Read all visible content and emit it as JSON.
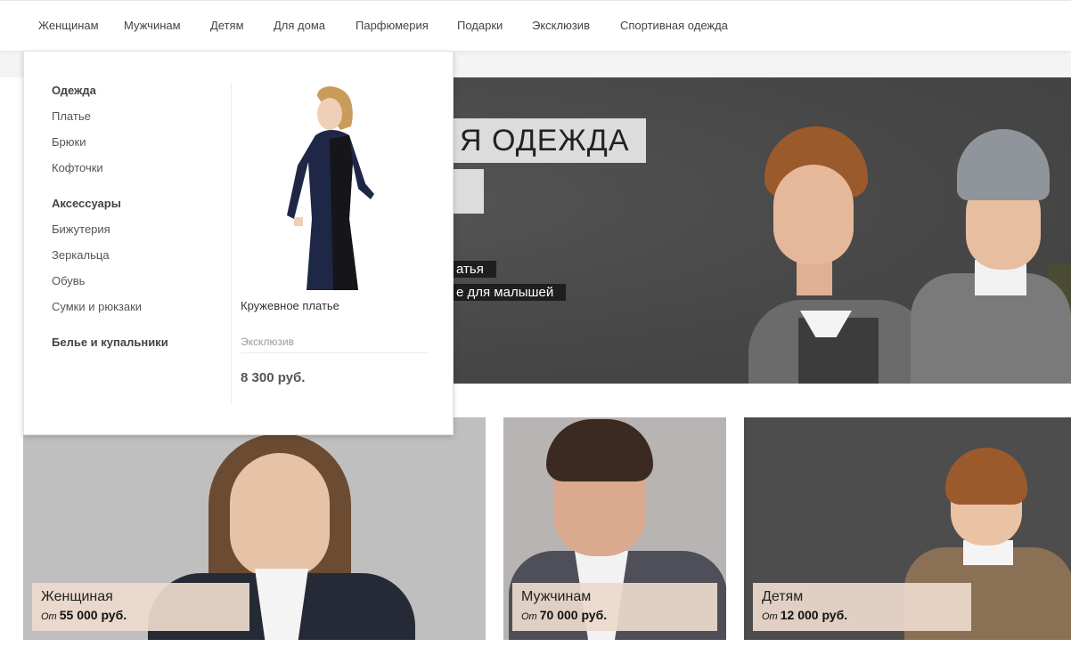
{
  "nav": {
    "items": [
      "Женщинам",
      "Мужчинам",
      "Детям",
      "Для дома",
      "Парфюмерия",
      "Подарки",
      "Эксклюзив",
      "Спортивная одежда"
    ]
  },
  "hero": {
    "title": "Я ОДЕЖДА",
    "line1": "атья",
    "line2": "е для малышей"
  },
  "dropdown": {
    "clothes_heading": "Одежда",
    "clothes_items": [
      "Платье",
      "Брюки",
      "Кофточки"
    ],
    "accessories_heading": "Аксессуары",
    "accessories_items": [
      "Бижутерия",
      "Зеркальца",
      "Обувь",
      "Сумки и рюкзаки"
    ],
    "lingerie_heading": "Белье и купальники",
    "product": {
      "name": "Кружевное платье",
      "tag": "Эксклюзив",
      "price": "8 300 руб."
    }
  },
  "cards": [
    {
      "name": "Женщиная",
      "from": "От",
      "price": "55 000 руб."
    },
    {
      "name": "Мужчинам",
      "from": "От",
      "price": "70 000 руб."
    },
    {
      "name": "Детям",
      "from": "От",
      "price": "12 000 руб."
    }
  ],
  "colors": {
    "hero_bg": "#4a4a4a",
    "card_label_bg": "#ecd9cb",
    "dress": "#1e2746"
  }
}
